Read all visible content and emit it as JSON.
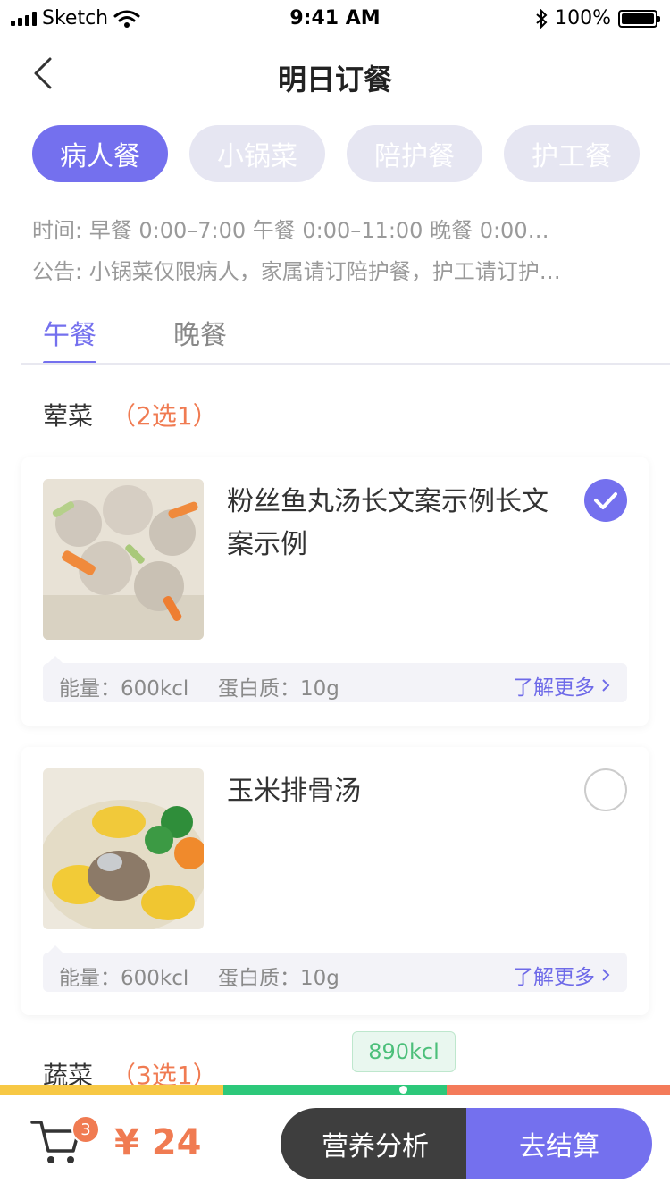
{
  "status_bar": {
    "carrier": "Sketch",
    "time": "9:41 AM",
    "battery": "100%"
  },
  "nav": {
    "title": "明日订餐"
  },
  "meal_types": [
    {
      "label": "病人餐",
      "active": true
    },
    {
      "label": "小锅菜",
      "active": false
    },
    {
      "label": "陪护餐",
      "active": false
    },
    {
      "label": "护工餐",
      "active": false
    }
  ],
  "info": {
    "time_line": "时间:  早餐   0:00–7:00    午餐   0:00–11:00    晚餐   0:00…",
    "notice_line": "公告:  小锅菜仅限病人，家属请订陪护餐，护工请订护…"
  },
  "tabs": [
    {
      "label": "午餐",
      "active": true
    },
    {
      "label": "晚餐",
      "active": false
    }
  ],
  "sections": [
    {
      "name": "荤菜",
      "rule": "（2选1）"
    },
    {
      "name": "蔬菜",
      "rule": "（3选1）"
    }
  ],
  "dishes": [
    {
      "name": "粉丝鱼丸汤长文案示例长文案示例",
      "energy": "能量：600kcl",
      "protein": "蛋白质：10g",
      "more": "了解更多",
      "selected": true
    },
    {
      "name": "玉米排骨汤",
      "energy": "能量：600kcl",
      "protein": "蛋白质：10g",
      "more": "了解更多",
      "selected": false
    }
  ],
  "calorie": {
    "label": "890kcl"
  },
  "cart": {
    "count": "3",
    "price": "¥ 24"
  },
  "actions": {
    "analysis": "营养分析",
    "checkout": "去结算"
  },
  "colors": {
    "accent": "#7470EE",
    "orange": "#F07B52",
    "bar_low": "#F7C845",
    "bar_mid": "#2DC87A",
    "bar_high": "#F47B5A"
  }
}
